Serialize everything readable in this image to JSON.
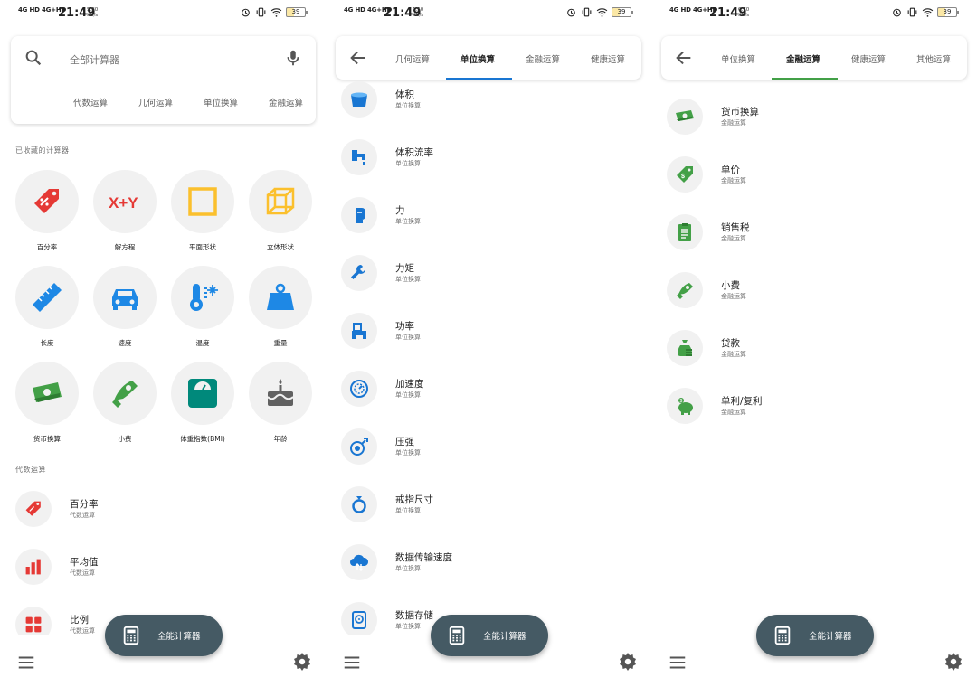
{
  "status": {
    "net": "4G HD 4G+HD",
    "time": "21:49",
    "speeds": [
      "5.80\nKB/s",
      "1.50\nKB/s",
      "0.70\nKB/s"
    ],
    "battery": "39"
  },
  "screen1": {
    "search_placeholder": "全部计算器",
    "category_tabs": [
      "代数运算",
      "几何运算",
      "单位换算",
      "金融运算"
    ],
    "favorites_label": "已收藏的计算器",
    "favorites": [
      {
        "label": "百分率",
        "icon": "percent-tag-icon"
      },
      {
        "label": "解方程",
        "icon": "x-plus-y-icon"
      },
      {
        "label": "平面形状",
        "icon": "square-icon"
      },
      {
        "label": "立体形状",
        "icon": "cube-icon"
      },
      {
        "label": "长度",
        "icon": "ruler-icon"
      },
      {
        "label": "速度",
        "icon": "car-icon"
      },
      {
        "label": "温度",
        "icon": "thermometer-icon"
      },
      {
        "label": "重量",
        "icon": "weight-icon"
      },
      {
        "label": "货币换算",
        "icon": "money-icon"
      },
      {
        "label": "小费",
        "icon": "tip-hand-icon"
      },
      {
        "label": "体重指数(BMI)",
        "icon": "scale-icon"
      },
      {
        "label": "年龄",
        "icon": "cake-icon"
      }
    ],
    "algebra_label": "代数运算",
    "algebra_items": [
      {
        "title": "百分率",
        "sub": "代数运算",
        "icon": "percent-tag-icon"
      },
      {
        "title": "平均值",
        "sub": "代数运算",
        "icon": "bar-chart-icon"
      },
      {
        "title": "比例",
        "sub": "代数运算",
        "icon": "grid-icon"
      }
    ]
  },
  "screen2": {
    "tabs": [
      "几何运算",
      "单位换算",
      "金融运算",
      "健康运算"
    ],
    "active_tab": "单位换算",
    "items": [
      {
        "title": "体积",
        "sub": "单位换算",
        "icon": "bucket-icon"
      },
      {
        "title": "体积流率",
        "sub": "单位换算",
        "icon": "faucet-icon"
      },
      {
        "title": "力",
        "sub": "单位换算",
        "icon": "boxing-glove-icon"
      },
      {
        "title": "力矩",
        "sub": "单位换算",
        "icon": "wrench-icon"
      },
      {
        "title": "功率",
        "sub": "单位换算",
        "icon": "tractor-icon"
      },
      {
        "title": "加速度",
        "sub": "单位换算",
        "icon": "speedometer-icon"
      },
      {
        "title": "压强",
        "sub": "单位换算",
        "icon": "pressure-icon"
      },
      {
        "title": "戒指尺寸",
        "sub": "单位换算",
        "icon": "ring-icon"
      },
      {
        "title": "数据传输速度",
        "sub": "单位换算",
        "icon": "cloud-transfer-icon"
      },
      {
        "title": "数据存储",
        "sub": "单位换算",
        "icon": "hard-drive-icon"
      }
    ]
  },
  "screen3": {
    "tabs": [
      "单位换算",
      "金融运算",
      "健康运算",
      "其他运算"
    ],
    "active_tab": "金融运算",
    "items": [
      {
        "title": "货币换算",
        "sub": "金融运算",
        "icon": "money-icon"
      },
      {
        "title": "单价",
        "sub": "金融运算",
        "icon": "price-tag-icon"
      },
      {
        "title": "销售税",
        "sub": "金融运算",
        "icon": "receipt-icon"
      },
      {
        "title": "小费",
        "sub": "金融运算",
        "icon": "tip-hand-icon"
      },
      {
        "title": "贷款",
        "sub": "金融运算",
        "icon": "money-bag-icon"
      },
      {
        "title": "单利/复利",
        "sub": "金融运算",
        "icon": "piggy-bank-icon"
      }
    ]
  },
  "fab_label": "全能计算器",
  "colors": {
    "algebra": "#e53935",
    "geometry": "#fbc02d",
    "unit": "#1976d2",
    "finance": "#43a047",
    "health": "#00897b",
    "fab": "#455a64"
  }
}
